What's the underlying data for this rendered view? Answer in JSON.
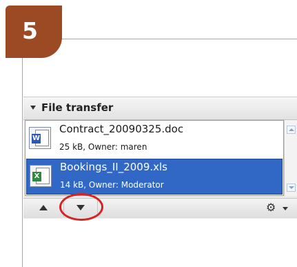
{
  "step": {
    "number": "5"
  },
  "panel": {
    "title": "File transfer",
    "files": [
      {
        "name": "Contract_20090325.doc",
        "meta": "25 kB, Owner: maren",
        "type": "word",
        "badge": "W",
        "selected": false
      },
      {
        "name": "Bookings_II_2009.xls",
        "meta": "14 kB, Owner: Moderator",
        "type": "excel",
        "badge": "X",
        "selected": true
      }
    ],
    "toolbar": {
      "move_up_icon": "up-arrow-icon",
      "move_down_icon": "down-arrow-icon",
      "settings_icon": "gear-icon",
      "settings_glyph": "⚙"
    }
  },
  "colors": {
    "badge": "#9b4a24",
    "selection": "#3168c6",
    "highlight": "#d42323"
  }
}
